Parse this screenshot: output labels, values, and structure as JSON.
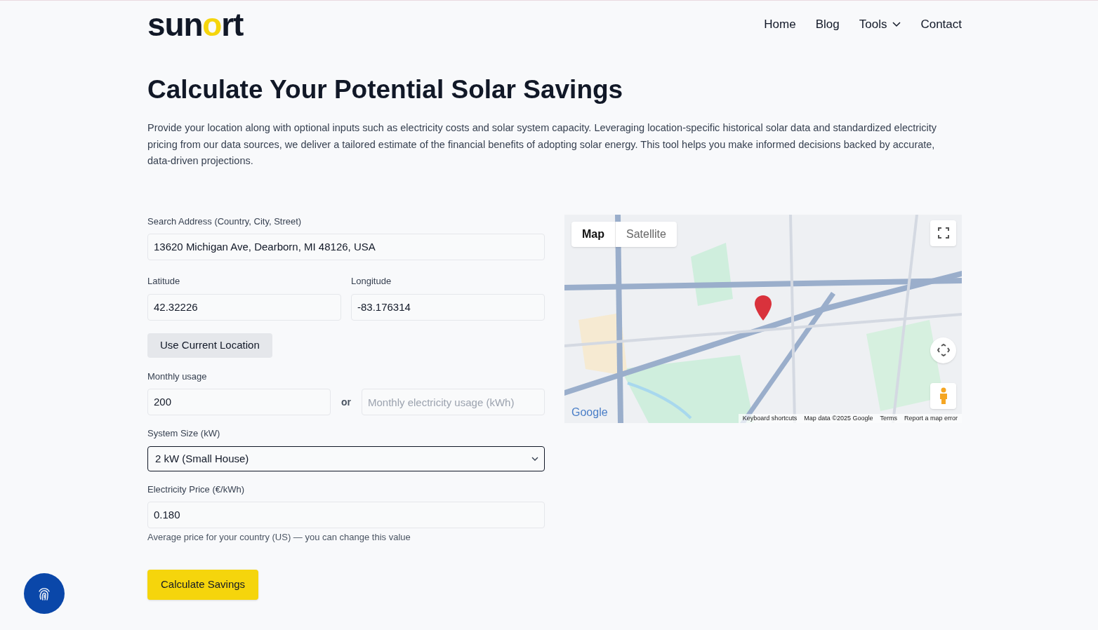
{
  "header": {
    "logo": [
      "sun",
      "o",
      "rt"
    ],
    "nav": [
      {
        "label": "Home",
        "dropdown": false
      },
      {
        "label": "Blog",
        "dropdown": false
      },
      {
        "label": "Tools",
        "dropdown": true
      },
      {
        "label": "Contact",
        "dropdown": false
      }
    ]
  },
  "title": "Calculate Your Potential Solar Savings",
  "intro": "Provide your location along with optional inputs such as electricity costs and solar system capacity. Leveraging location-specific historical solar data and standardized electricity pricing from our data sources, we deliver a tailored estimate of the financial benefits of adopting solar energy. This tool helps you make informed decisions backed by accurate, data-driven projections.",
  "form": {
    "address": {
      "label": "Search Address (Country, City, Street)",
      "value": "13620 Michigan Ave, Dearborn, MI 48126, USA"
    },
    "latitude": {
      "label": "Latitude",
      "value": "42.32226"
    },
    "longitude": {
      "label": "Longitude",
      "value": "-83.176314"
    },
    "location_button": "Use Current Location",
    "monthly_usage": {
      "label": "Monthly usage",
      "value": "200",
      "separator": "or",
      "placeholder": "Monthly electricity usage (kWh)"
    },
    "system_size": {
      "label": "System Size (kW)",
      "value": "2 kW (Small House)",
      "focused": true
    },
    "price": {
      "label": "Electricity Price (€/kWh)",
      "value": "0.180",
      "hint": "Average price for your country (US) — you can change this value"
    },
    "submit": "Calculate Savings"
  },
  "map": {
    "kind": "picture",
    "tabs": [
      {
        "label": "Map",
        "selected": true
      },
      {
        "label": "Satellite",
        "selected": false
      }
    ],
    "logo": "Google",
    "footer": [
      "Keyboard shortcuts",
      "Map data ©2025 Google",
      "Terms",
      "Report a map error"
    ]
  }
}
